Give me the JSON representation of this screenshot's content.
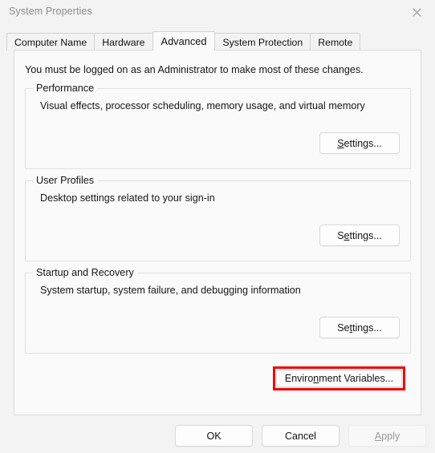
{
  "window": {
    "title": "System Properties",
    "close_icon": "close-icon",
    "active": false
  },
  "tabs": [
    {
      "label": "Computer Name",
      "active": false
    },
    {
      "label": "Hardware",
      "active": false
    },
    {
      "label": "Advanced",
      "active": true
    },
    {
      "label": "System Protection",
      "active": false
    },
    {
      "label": "Remote",
      "active": false
    }
  ],
  "page": {
    "intro": "You must be logged on as an Administrator to make most of these changes.",
    "groups": [
      {
        "legend": "Performance",
        "description": "Visual effects, processor scheduling, memory usage, and virtual memory",
        "button": {
          "pre": "S",
          "accel": "",
          "post": "ettings...",
          "full": "Settings..."
        }
      },
      {
        "legend": "User Profiles",
        "description": "Desktop settings related to your sign-in",
        "button": {
          "pre": "S",
          "accel": "e",
          "post": "ttings...",
          "full": "Settings..."
        }
      },
      {
        "legend": "Startup and Recovery",
        "description": "System startup, system failure, and debugging information",
        "button": {
          "pre": "Se",
          "accel": "t",
          "post": "tings...",
          "full": "Settings..."
        }
      }
    ],
    "environment_button": {
      "pre": "Enviro",
      "accel": "n",
      "post": "ment Variables...",
      "full": "Environment Variables..."
    }
  },
  "footer": {
    "ok": {
      "label": "OK"
    },
    "cancel": {
      "label": "Cancel"
    },
    "apply": {
      "pre": "",
      "accel": "A",
      "post": "pply",
      "full": "Apply",
      "enabled": false
    }
  },
  "annotation": {
    "type": "highlight-rectangle",
    "target": "environment-variables-button",
    "color": "#f50000"
  },
  "colors": {
    "window_bg": "#f3f3f3",
    "page_bg": "#fafafa",
    "border": "#dcdcdc",
    "group_border": "#e2e2e2",
    "text": "#161616",
    "title_text": "#8d8d8d",
    "disabled_text": "#9a9a9a",
    "annotation_red": "#f50000"
  }
}
